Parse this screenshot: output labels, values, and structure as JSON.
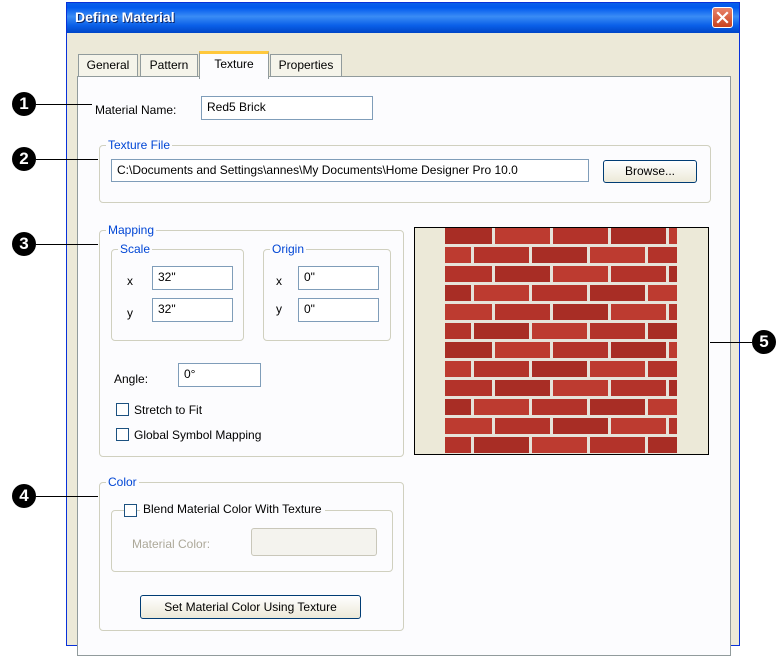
{
  "window": {
    "title": "Define Material"
  },
  "tabs": [
    {
      "label": "General"
    },
    {
      "label": "Pattern"
    },
    {
      "label": "Texture"
    },
    {
      "label": "Properties"
    }
  ],
  "material_name": {
    "label": "Material Name:",
    "value": "Red5 Brick"
  },
  "texture_file": {
    "group_title": "Texture File",
    "path": "C:\\Documents and Settings\\annes\\My Documents\\Home Designer Pro 10.0",
    "browse_label": "Browse..."
  },
  "mapping": {
    "group_title": "Mapping",
    "scale": {
      "title": "Scale",
      "x_label": "x",
      "x_value": "32\"",
      "y_label": "y",
      "y_value": "32\""
    },
    "origin": {
      "title": "Origin",
      "x_label": "x",
      "x_value": "0\"",
      "y_label": "y",
      "y_value": "0\""
    },
    "angle_label": "Angle:",
    "angle_value": "0°",
    "stretch_label": "Stretch to Fit",
    "global_label": "Global Symbol Mapping"
  },
  "color": {
    "group_title": "Color",
    "blend_label": "Blend Material Color With Texture",
    "material_color_label": "Material Color:",
    "set_color_label": "Set Material Color Using Texture"
  },
  "callouts": [
    "1",
    "2",
    "3",
    "4",
    "5"
  ],
  "colors": {
    "brick": "#b3332a",
    "mortar": "#e6e3da",
    "accent": "#0046d5"
  }
}
